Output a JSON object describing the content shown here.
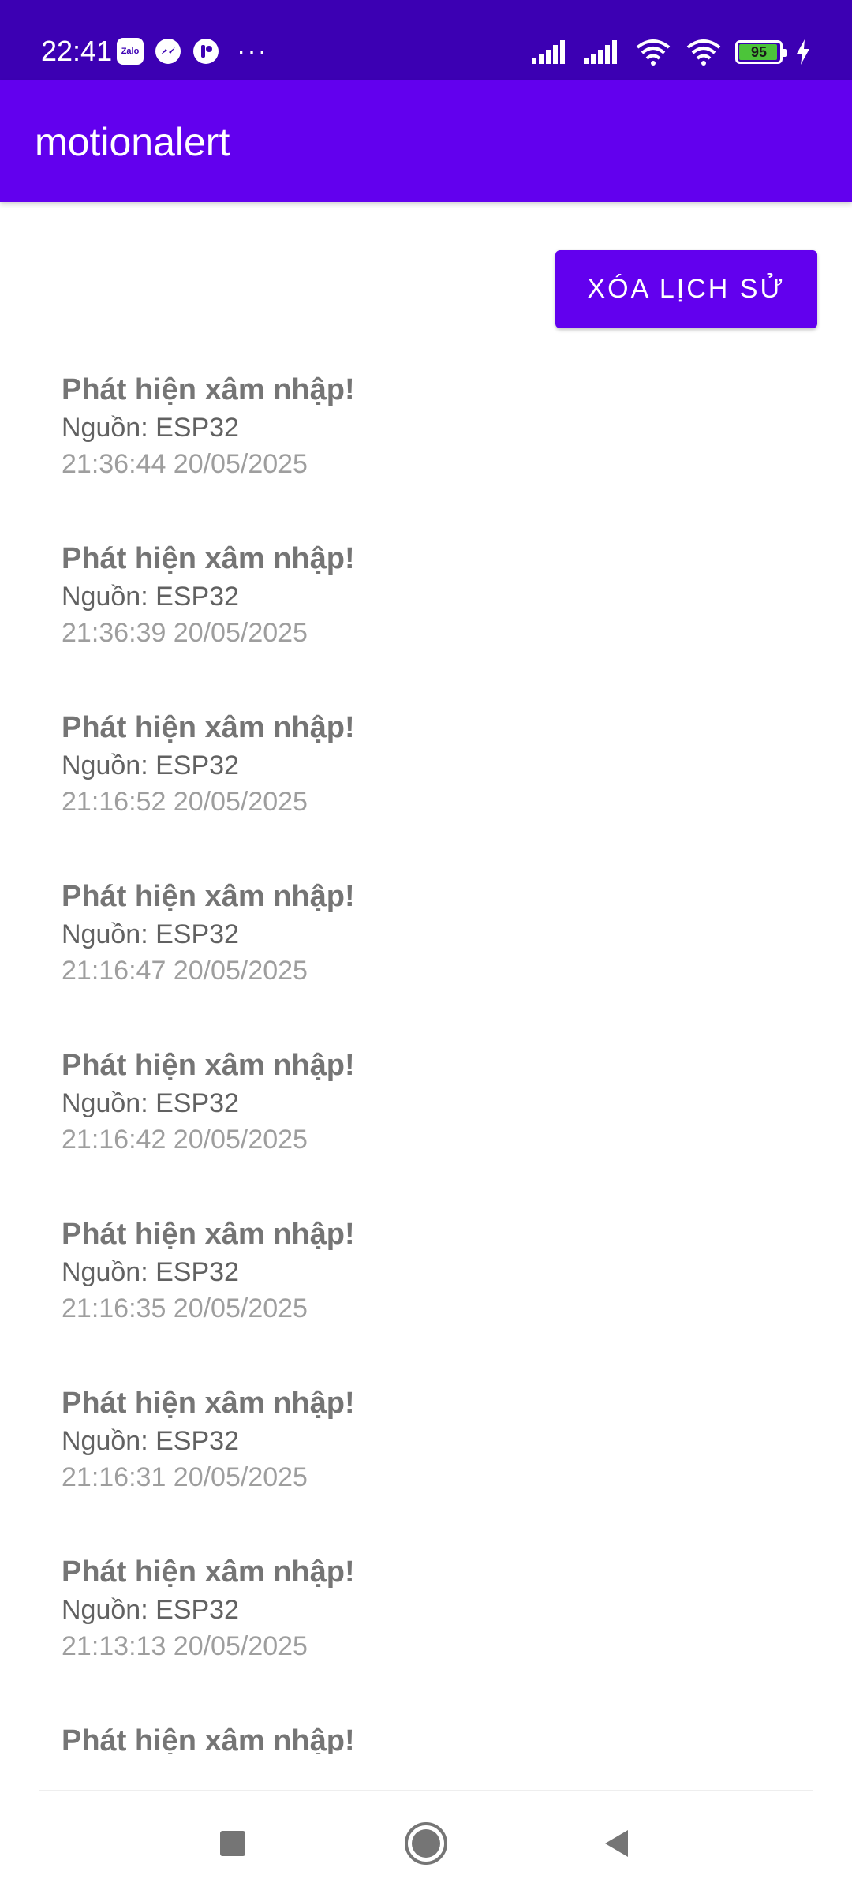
{
  "status_bar": {
    "time": "22:41",
    "notification_icons": [
      "zalo-icon",
      "messenger-icon",
      "app-notification-icon",
      "more-notifications-icon"
    ],
    "zalo_label": "Zalo",
    "more": "···",
    "battery_level": "95",
    "battery_fraction": 0.95,
    "system_icons": [
      "signal-icon",
      "signal-icon",
      "wifi-icon",
      "wifi-icon",
      "battery-icon",
      "charging-icon"
    ]
  },
  "app_bar": {
    "title": "motionalert"
  },
  "actions": {
    "clear_history_label": "XÓA LỊCH SỬ"
  },
  "history": [
    {
      "title": "Phát hiện xâm nhập!",
      "source": "Nguồn: ESP32",
      "time": "21:36:44 20/05/2025"
    },
    {
      "title": "Phát hiện xâm nhập!",
      "source": "Nguồn: ESP32",
      "time": "21:36:39 20/05/2025"
    },
    {
      "title": "Phát hiện xâm nhập!",
      "source": "Nguồn: ESP32",
      "time": "21:16:52 20/05/2025"
    },
    {
      "title": "Phát hiện xâm nhập!",
      "source": "Nguồn: ESP32",
      "time": "21:16:47 20/05/2025"
    },
    {
      "title": "Phát hiện xâm nhập!",
      "source": "Nguồn: ESP32",
      "time": "21:16:42 20/05/2025"
    },
    {
      "title": "Phát hiện xâm nhập!",
      "source": "Nguồn: ESP32",
      "time": "21:16:35 20/05/2025"
    },
    {
      "title": "Phát hiện xâm nhập!",
      "source": "Nguồn: ESP32",
      "time": "21:16:31 20/05/2025"
    },
    {
      "title": "Phát hiện xâm nhập!",
      "source": "Nguồn: ESP32",
      "time": "21:13:13 20/05/2025"
    },
    {
      "title": "Phát hiện xâm nhập!",
      "source": "",
      "time": ""
    }
  ],
  "nav_bar": {
    "icons": [
      "recents-square-icon",
      "home-circle-icon",
      "back-triangle-icon"
    ]
  },
  "colors": {
    "status_bar": "#3c00b3",
    "primary": "#6200ee",
    "title_text": "#757575",
    "source_text": "#616161",
    "time_text": "#9e9e9e",
    "battery_green": "#4cc43a"
  }
}
